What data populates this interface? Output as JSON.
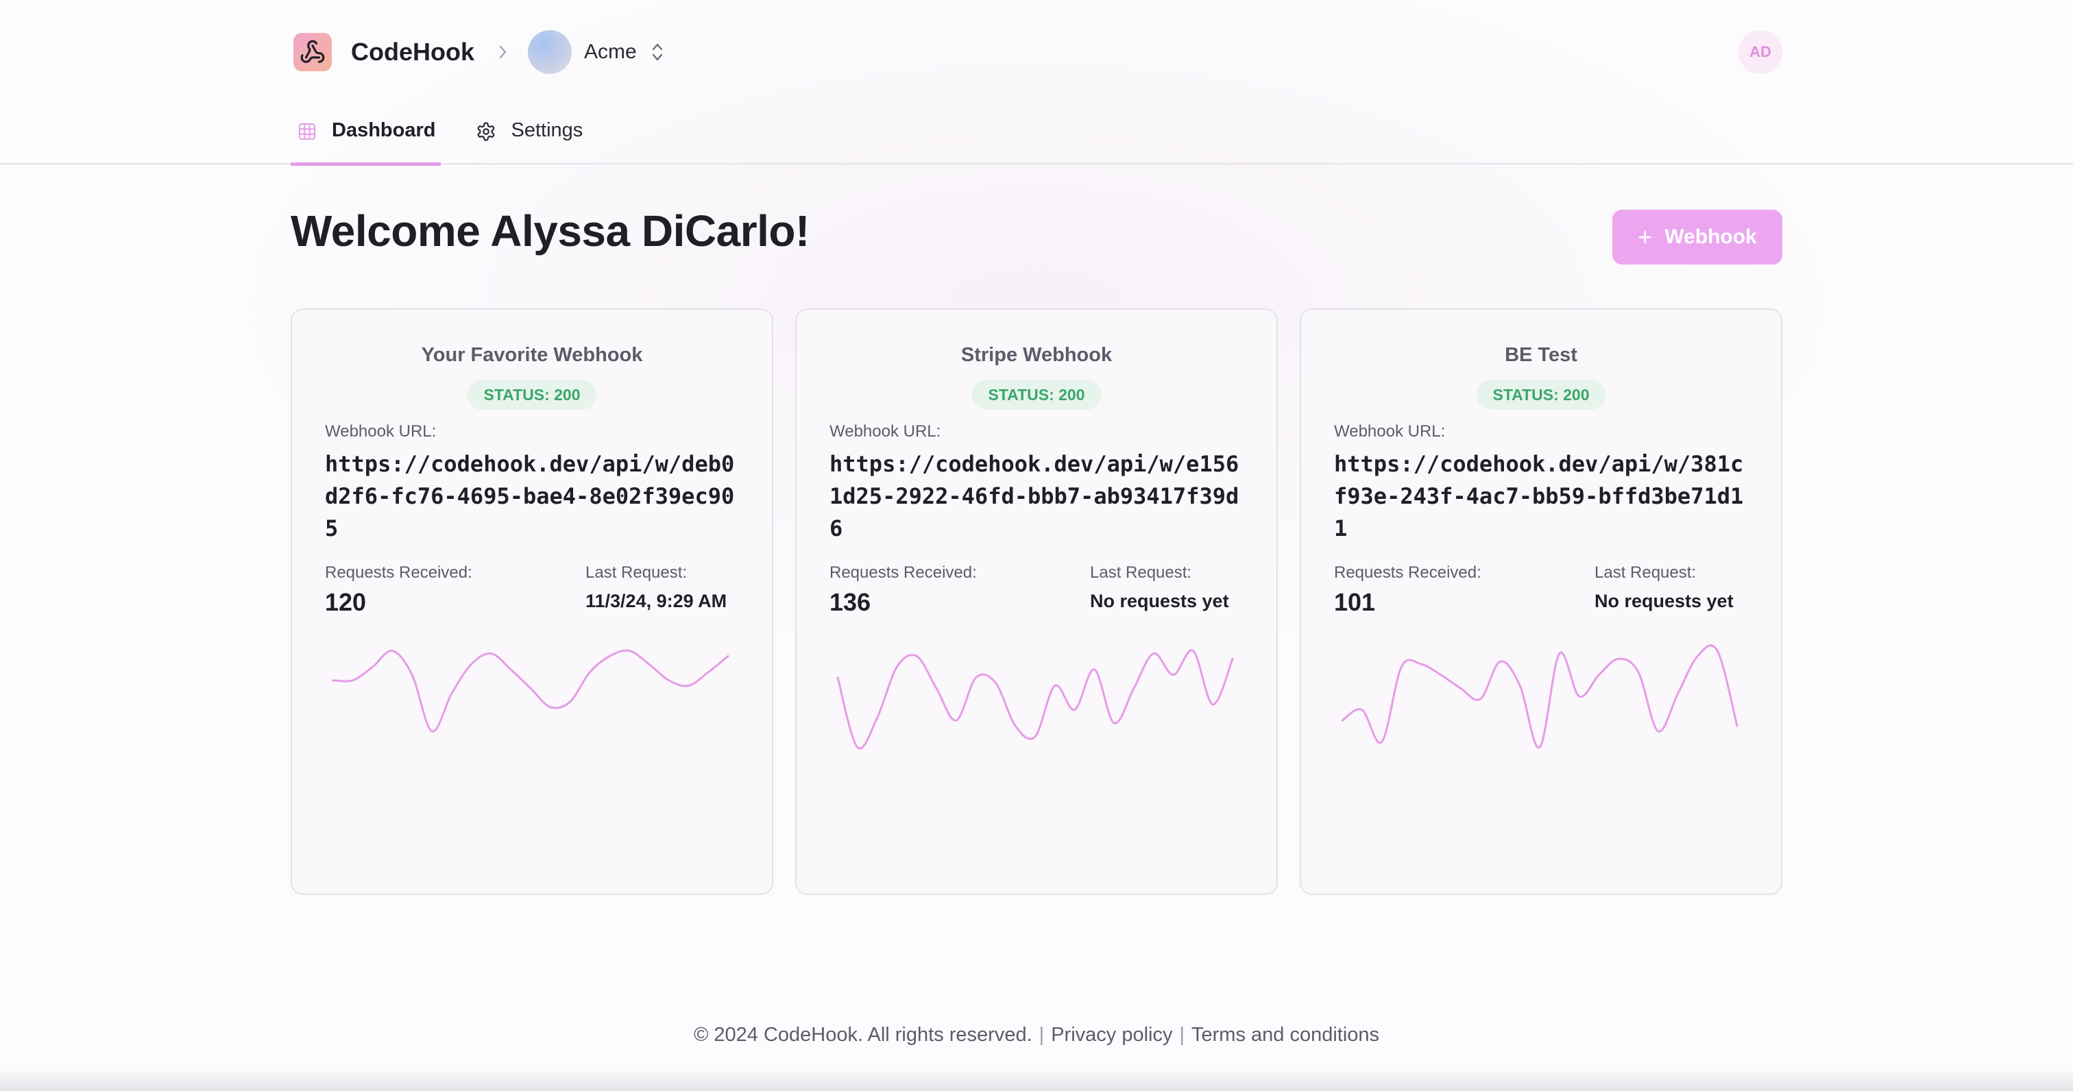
{
  "header": {
    "app_name": "CodeHook",
    "logo_icon": "webhook-icon",
    "org_name": "Acme",
    "user_initials": "AD"
  },
  "tabs": [
    {
      "label": "Dashboard",
      "icon": "grid-icon",
      "active": true
    },
    {
      "label": "Settings",
      "icon": "gear-icon",
      "active": false
    }
  ],
  "main": {
    "welcome": "Welcome Alyssa DiCarlo!",
    "add_button": {
      "icon": "plus-icon",
      "label": "Webhook"
    }
  },
  "labels": {
    "webhook_url": "Webhook URL:",
    "requests_received": "Requests Received:",
    "last_request": "Last Request:"
  },
  "cards": [
    {
      "title": "Your Favorite Webhook",
      "status": "STATUS: 200",
      "url": "https://codehook.dev/api/w/deb0d2f6-fc76-4695-bae4-8e02f39ec905",
      "requests": "120",
      "last_request": "11/3/24, 9:29 AM",
      "activity": [
        5.5,
        5.5,
        6.0,
        6.6,
        5.7,
        3.6,
        5.0,
        6.1,
        6.5,
        5.9,
        5.2,
        4.5,
        4.7,
        5.8,
        6.4,
        6.6,
        6.1,
        5.5,
        5.3,
        5.8,
        6.4
      ]
    },
    {
      "title": "Stripe Webhook",
      "status": "STATUS: 200",
      "url": "https://codehook.dev/api/w/e1561d25-2922-46fd-bbb7-ab93417f39d6",
      "requests": "136",
      "last_request": "No requests yet",
      "activity": [
        5.6,
        3.0,
        4.1,
        6.0,
        6.4,
        5.2,
        4.0,
        5.6,
        5.4,
        3.8,
        3.4,
        5.3,
        4.4,
        5.9,
        3.9,
        5.2,
        6.5,
        5.7,
        6.6,
        4.6,
        6.3
      ]
    },
    {
      "title": "BE Test",
      "status": "STATUS: 200",
      "url": "https://codehook.dev/api/w/381cf93e-243f-4ac7-bb59-bffd3be71d11",
      "requests": "101",
      "last_request": "No requests yet",
      "activity": [
        4.0,
        4.4,
        3.2,
        6.0,
        6.1,
        5.7,
        5.2,
        4.8,
        6.2,
        5.3,
        3.0,
        6.5,
        4.9,
        5.7,
        6.3,
        5.8,
        3.6,
        5.0,
        6.4,
        6.6,
        3.8
      ]
    }
  ],
  "footer": {
    "copyright": "© 2024 CodeHook. All rights reserved.",
    "privacy": "Privacy policy",
    "terms": "Terms and conditions"
  },
  "colors": {
    "accent": "#eca6f0",
    "sparkline": "#e79be8",
    "status_green": "#3ba56a"
  }
}
